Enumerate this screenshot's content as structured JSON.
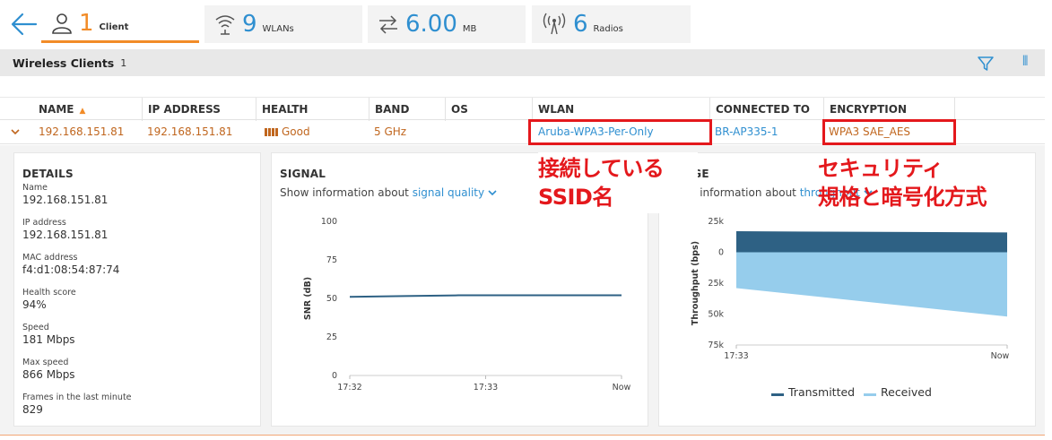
{
  "summary_tabs": [
    {
      "count": "1",
      "label": "Client",
      "icon": "user-icon",
      "active": true
    },
    {
      "count": "9",
      "label": "WLANs",
      "icon": "wifi-icon"
    },
    {
      "count": "6.00",
      "label": "MB",
      "icon": "transfer-arrows-icon"
    },
    {
      "count": "6",
      "label": "Radios",
      "icon": "radio-antenna-icon"
    }
  ],
  "section": {
    "title": "Wireless Clients",
    "count": "1"
  },
  "table": {
    "columns": [
      "NAME",
      "IP ADDRESS",
      "HEALTH",
      "BAND",
      "OS",
      "WLAN",
      "CONNECTED TO",
      "ENCRYPTION"
    ],
    "rows": [
      {
        "name": "192.168.151.81",
        "ip": "192.168.151.81",
        "health": "Good",
        "band": "5 GHz",
        "os": "",
        "wlan": "Aruba-WPA3-Per-Only",
        "connected_to": "BR-AP335-1",
        "encryption": "WPA3 SAE_AES"
      }
    ]
  },
  "details": {
    "title": "DETAILS",
    "fields": [
      {
        "label": "Name",
        "value": "192.168.151.81"
      },
      {
        "label": "IP address",
        "value": "192.168.151.81"
      },
      {
        "label": "MAC address",
        "value": "f4:d1:08:54:87:74"
      },
      {
        "label": "Health score",
        "value": "94%"
      },
      {
        "label": "Speed",
        "value": "181 Mbps"
      },
      {
        "label": "Max speed",
        "value": "866 Mbps"
      },
      {
        "label": "Frames in the last minute",
        "value": "829"
      }
    ]
  },
  "signal": {
    "title": "SIGNAL",
    "show_prefix": "Show information about",
    "selector": "signal quality"
  },
  "usage": {
    "title": "USAGE",
    "show_prefix": "Show information about",
    "selector": "throughput"
  },
  "annotations": {
    "wlan_note_line1": "接続している",
    "wlan_note_line2": "SSID名",
    "enc_note_line1": "セキュリティ",
    "enc_note_line2": "規格と暗号化方式"
  },
  "colors": {
    "accent_orange": "#f28c28",
    "link_blue": "#2f8fd0",
    "transmitted": "#2e6184",
    "received": "#96cdec",
    "annotation_red": "#e4181c"
  },
  "chart_data": [
    {
      "type": "line",
      "title": "",
      "xlabel": "",
      "ylabel": "SNR (dB)",
      "x_ticks": [
        "17:32",
        "17:33",
        "Now"
      ],
      "y_ticks": [
        0,
        25,
        50,
        75,
        100
      ],
      "ylim": [
        0,
        100
      ],
      "series": [
        {
          "values": [
            51,
            51.5,
            52,
            52,
            52,
            52
          ]
        }
      ],
      "grid": false
    },
    {
      "type": "area",
      "title": "",
      "xlabel": "",
      "ylabel": "Throughput (bps)",
      "x_ticks": [
        "17:33",
        "Now"
      ],
      "y_ticks": [
        "25k",
        "0",
        "25k",
        "50k",
        "75k"
      ],
      "ylim": [
        -75000,
        25000
      ],
      "series": [
        {
          "name": "Transmitted",
          "start": 17000,
          "end": 16000
        },
        {
          "name": "Received",
          "start": -29000,
          "end": -52000
        }
      ],
      "legend": "bottom"
    }
  ]
}
